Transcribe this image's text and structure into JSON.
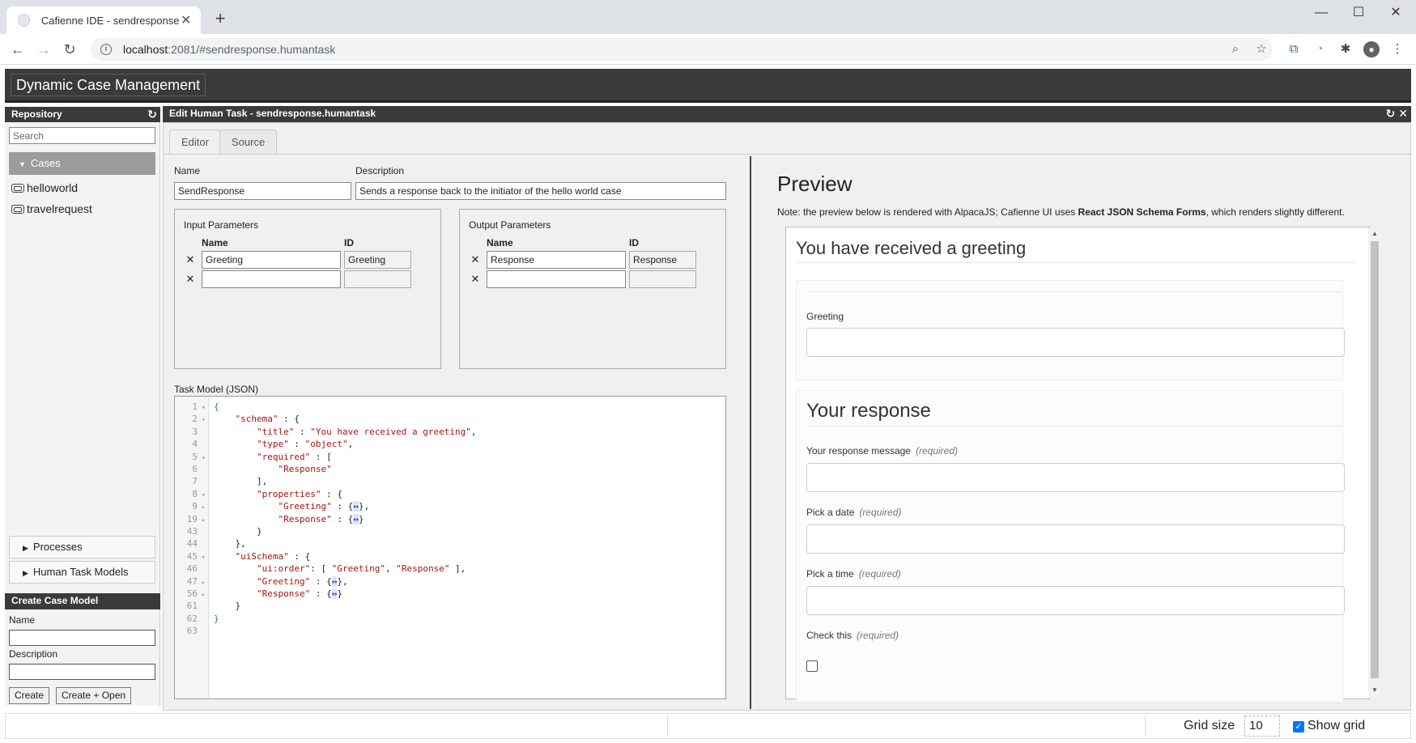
{
  "browser": {
    "tab_title": "Cafienne IDE - sendresponse",
    "url_host": "localhost",
    "url_path": ":2081/#sendresponse.humantask"
  },
  "app": {
    "title": "Dynamic Case Management"
  },
  "repository": {
    "title": "Repository",
    "search_placeholder": "Search",
    "cases_label": "Cases",
    "items": [
      "helloworld",
      "travelrequest"
    ],
    "processes_label": "Processes",
    "human_task_models_label": "Human Task Models"
  },
  "create_case_model": {
    "title": "Create Case Model",
    "name_label": "Name",
    "description_label": "Description",
    "create_label": "Create",
    "create_open_label": "Create + Open"
  },
  "editor": {
    "title": "Edit Human Task - sendresponse.humantask",
    "tabs": [
      "Editor",
      "Source"
    ],
    "name_label": "Name",
    "name_value": "SendResponse",
    "description_label": "Description",
    "description_value": "Sends a response back to the initiator of the hello world case",
    "input_params": {
      "title": "Input Parameters",
      "col_name": "Name",
      "col_id": "ID",
      "rows": [
        {
          "name": "Greeting",
          "id": "Greeting"
        },
        {
          "name": "",
          "id": ""
        }
      ]
    },
    "output_params": {
      "title": "Output Parameters",
      "col_name": "Name",
      "col_id": "ID",
      "rows": [
        {
          "name": "Response",
          "id": "Response"
        },
        {
          "name": "",
          "id": ""
        }
      ]
    },
    "task_model_label": "Task Model (JSON)",
    "code_lines": [
      {
        "n": "1",
        "fold": true
      },
      {
        "n": "2",
        "fold": true
      },
      {
        "n": "3",
        "fold": false
      },
      {
        "n": "4",
        "fold": false
      },
      {
        "n": "5",
        "fold": true
      },
      {
        "n": "6",
        "fold": false
      },
      {
        "n": "7",
        "fold": false
      },
      {
        "n": "8",
        "fold": true
      },
      {
        "n": "9",
        "fold": "closed"
      },
      {
        "n": "19",
        "fold": "closed"
      },
      {
        "n": "43",
        "fold": false
      },
      {
        "n": "44",
        "fold": false
      },
      {
        "n": "45",
        "fold": true
      },
      {
        "n": "46",
        "fold": false
      },
      {
        "n": "47",
        "fold": "closed"
      },
      {
        "n": "56",
        "fold": "closed"
      },
      {
        "n": "61",
        "fold": false
      },
      {
        "n": "62",
        "fold": false
      },
      {
        "n": "63",
        "fold": false
      }
    ]
  },
  "preview": {
    "title": "Preview",
    "note_pre": "Note: the preview below is rendered with AlpacaJS; Cafienne UI uses ",
    "note_bold": "React JSON Schema Forms",
    "note_post": ", which renders slightly different.",
    "form_title": "You have received a greeting",
    "greeting_label": "Greeting",
    "section_title": "Your response",
    "required_text": "(required)",
    "fields": [
      "Your response message",
      "Pick a date",
      "Pick a time",
      "Check this"
    ]
  },
  "statusbar": {
    "grid_size_label": "Grid size",
    "grid_size_value": "10",
    "show_grid_label": "Show grid"
  },
  "colors": {
    "header_bg": "#3a3a3a",
    "checkbox_blue": "#0075ff"
  }
}
